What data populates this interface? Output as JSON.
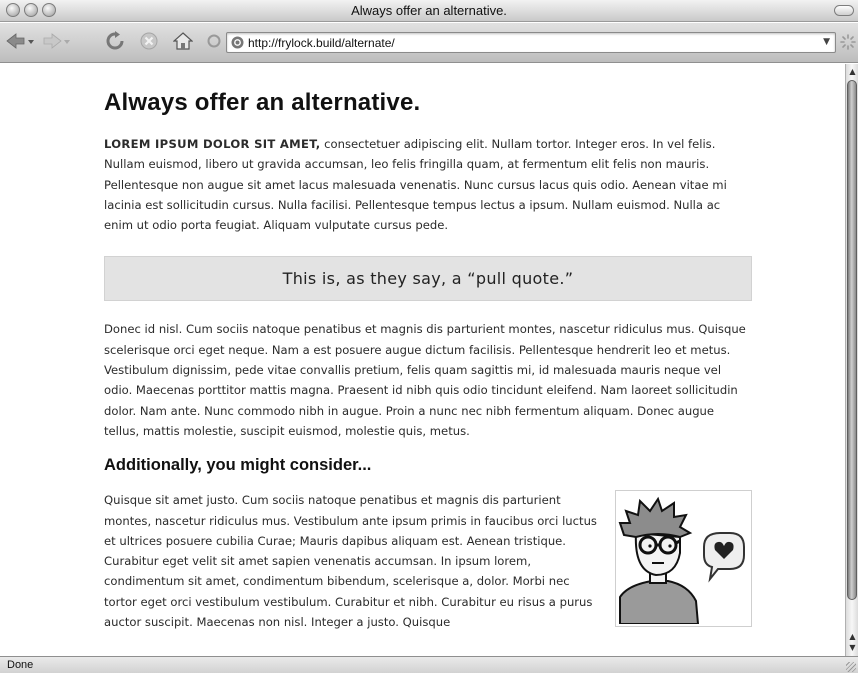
{
  "window": {
    "title": "Always offer an alternative."
  },
  "toolbar": {
    "url": "http://frylock.build/alternate/",
    "icons": [
      "back-icon",
      "forward-icon",
      "reload-icon",
      "stop-icon",
      "home-icon",
      "throbber-icon"
    ]
  },
  "page": {
    "heading": "Always offer an alternative.",
    "intro_lede": "LOREM IPSUM DOLOR SIT AMET,",
    "intro_text": " consectetuer adipiscing elit. Nullam tortor. Integer eros. In vel felis. Nullam euismod, libero ut gravida accumsan, leo felis fringilla quam, at fermentum elit felis non mauris. Pellentesque non augue sit amet lacus malesuada venenatis. Nunc cursus lacus quis odio. Aenean vitae mi lacinia est sollicitudin cursus. Nulla facilisi. Pellentesque tempus lectus a ipsum. Nullam euismod. Nulla ac enim ut odio porta feugiat. Aliquam vulputate cursus pede.",
    "pull_quote": "This is, as they say, a “pull quote.”",
    "paragraph2": "Donec id nisl. Cum sociis natoque penatibus et magnis dis parturient montes, nascetur ridiculus mus. Quisque scelerisque orci eget neque. Nam a est posuere augue dictum facilisis. Pellentesque hendrerit leo et metus. Vestibulum dignissim, pede vitae convallis pretium, felis quam sagittis mi, id malesuada mauris neque vel odio. Maecenas porttitor mattis magna. Praesent id nibh quis odio tincidunt eleifend. Nam laoreet sollicitudin dolor. Nam ante. Nunc commodo nibh in augue. Proin a nunc nec nibh fermentum aliquam. Donec augue tellus, mattis molestie, suscipit euismod, molestie quis, metus.",
    "subheading": "Additionally, you might consider...",
    "paragraph3": "Quisque sit amet justo. Cum sociis natoque penatibus et magnis dis parturient montes, nascetur ridiculus mus. Vestibulum ante ipsum primis in faucibus orci luctus et ultrices posuere cubilia Curae; Mauris dapibus aliquam est. Aenean tristique. Curabitur eget velit sit amet sapien venenatis accumsan. In ipsum lorem, condimentum sit amet, condimentum bibendum, scelerisque a, dolor. Morbi nec tortor eget orci vestibulum vestibulum. Curabitur et nibh. Curabitur eu risus a purus auctor suscipit. Maecenas non nisl. Integer a justo. Quisque",
    "figure_icon": "avatar-heart-illustration"
  },
  "status": {
    "text": "Done"
  }
}
